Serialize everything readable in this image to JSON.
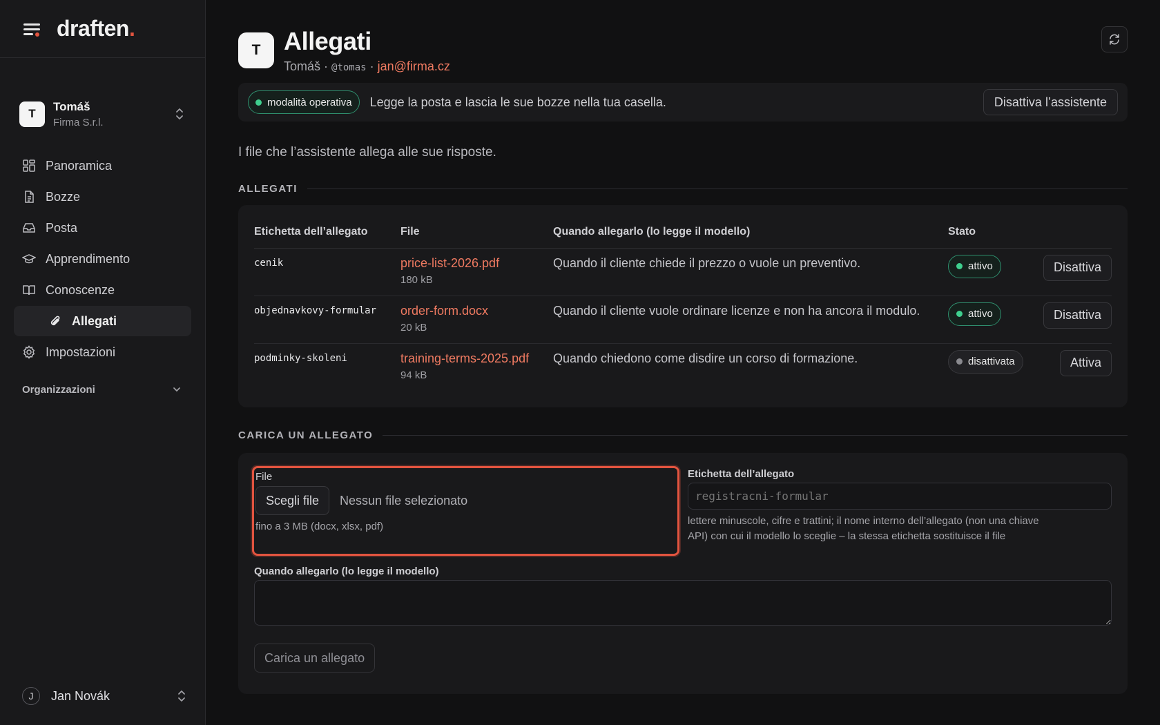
{
  "app": {
    "brand": "draften",
    "brand_dot": "."
  },
  "sidebar": {
    "org": {
      "avatar": "T",
      "name": "Tomáš",
      "sub": "Firma S.r.l."
    },
    "items": [
      {
        "label": "Panoramica",
        "icon": "dashboard-icon"
      },
      {
        "label": "Bozze",
        "icon": "document-icon"
      },
      {
        "label": "Posta",
        "icon": "inbox-icon"
      },
      {
        "label": "Apprendimento",
        "icon": "graduation-cap-icon"
      },
      {
        "label": "Conoscenze",
        "icon": "book-icon"
      },
      {
        "label": "Allegati",
        "icon": "paperclip-icon",
        "active": true
      },
      {
        "label": "Impostazioni",
        "icon": "gear-icon"
      }
    ],
    "group_label": "Organizzazioni",
    "user": {
      "avatar": "J",
      "name": "Jan Novák"
    }
  },
  "header": {
    "avatar": "T",
    "title": "Allegati",
    "meta_name": "Tomáš",
    "meta_sep1": " · ",
    "meta_handle": "@tomas",
    "meta_sep2": " · ",
    "meta_email": "jan@firma.cz"
  },
  "mode": {
    "pill": "modalità operativa",
    "text": "Legge la posta e lascia le sue bozze nella tua casella.",
    "button": "Disattiva l’assistente"
  },
  "intro": "I file che l’assistente allega alle sue risposte.",
  "attachments": {
    "section_title": "ALLEGATI",
    "columns": [
      "Etichetta dell’allegato",
      "File",
      "Quando allegarlo (lo legge il modello)",
      "Stato"
    ],
    "rows": [
      {
        "label": "cenik",
        "file": "price-list-2026.pdf",
        "size": "180 kB",
        "when": "Quando il cliente chiede il prezzo o vuole un preventivo.",
        "status": "attivo",
        "action": "Disattiva"
      },
      {
        "label": "objednavkovy-formular",
        "file": "order-form.docx",
        "size": "20 kB",
        "when": "Quando il cliente vuole ordinare licenze e non ha ancora il modulo.",
        "status": "attivo",
        "action": "Disattiva"
      },
      {
        "label": "podminky-skoleni",
        "file": "training-terms-2025.pdf",
        "size": "94 kB",
        "when": "Quando chiedono come disdire un corso di formazione.",
        "status": "disattivata",
        "action": "Attiva"
      }
    ]
  },
  "upload": {
    "section_title": "CARICA UN ALLEGATO",
    "file_label": "File",
    "choose_button": "Scegli file",
    "no_file": "Nessun file selezionato",
    "file_hint": "fino a 3 MB (docx, xlsx, pdf)",
    "label_label": "Etichetta dell’allegato",
    "label_placeholder": "registracni-formular",
    "label_help": "lettere minuscole, cifre e trattini; il nome interno dell’allegato (non una chiave API) con cui il modello lo sceglie – la stessa etichetta sostituisce il file",
    "when_label": "Quando allegarlo (lo legge il modello)",
    "submit": "Carica un allegato"
  },
  "colors": {
    "accent": "#e2543f",
    "link": "#ef7a61",
    "active_green": "#3fcf8e"
  }
}
